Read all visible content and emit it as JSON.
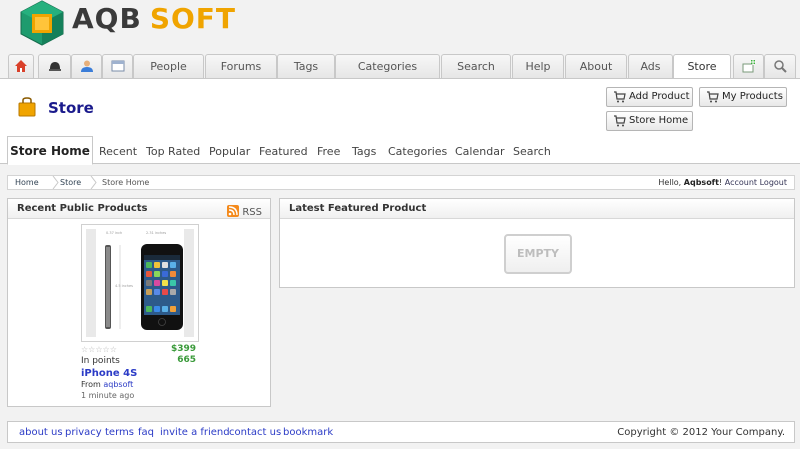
{
  "brand": {
    "part1": "AQB",
    "part2": "SOFT",
    "hex_color": "#1e9b6e",
    "accent": "#f0a400"
  },
  "tabs": {
    "icons": [
      "home-icon",
      "helmet-icon",
      "user-icon",
      "window-icon"
    ],
    "labels": [
      "People",
      "Forums",
      "Tags",
      "Categories",
      "Search",
      "Help",
      "About",
      "Ads",
      "Store"
    ],
    "active": "Store",
    "right_icons": [
      "add-widget-icon",
      "magnifier-icon"
    ]
  },
  "store": {
    "title": "Store",
    "add_product": "Add Product",
    "my_products": "My Products",
    "store_home": "Store Home"
  },
  "subnav": {
    "active": "Store Home",
    "items": [
      "Recent",
      "Top Rated",
      "Popular",
      "Featured",
      "Free",
      "Tags",
      "Categories",
      "Calendar",
      "Search"
    ]
  },
  "breadcrumb": {
    "items": [
      "Home",
      "Store",
      "Store Home"
    ],
    "hello_prefix": "Hello,",
    "user": "Aqbsoft",
    "account": "Account",
    "logout": "Logout"
  },
  "recent": {
    "title": "Recent Public Products",
    "rss": "RSS",
    "product": {
      "price": "$399",
      "in_points_label": "In points",
      "points": "665",
      "name": "iPhone 4S",
      "from_label": "From",
      "author": "aqbsoft",
      "ago": "1 minute ago",
      "rating": 0,
      "rating_max": 5
    }
  },
  "featured": {
    "title": "Latest Featured Product",
    "empty": "EMPTY"
  },
  "footer": {
    "links": [
      "about us",
      "privacy",
      "terms",
      "faq",
      "invite a friend",
      "contact us",
      "bookmark"
    ],
    "copyright": "Copyright © 2012 Your Company."
  }
}
